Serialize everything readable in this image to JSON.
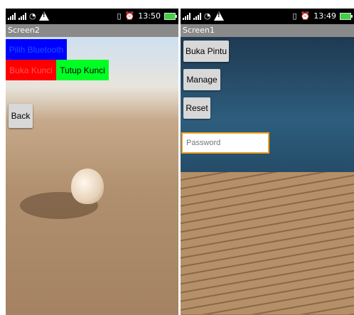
{
  "left_phone": {
    "status": {
      "time": "13:50"
    },
    "title": "Screen2",
    "buttons": {
      "pilih": "Pilih Bluetooth",
      "buka": "Buka Kunci",
      "tutup": "Tutup Kunci",
      "back": "Back"
    }
  },
  "right_phone": {
    "status": {
      "time": "13:49"
    },
    "title": "Screen1",
    "buttons": {
      "buka_pintu": "Buka Pintu",
      "manage": "Manage",
      "reset": "Reset"
    },
    "password": {
      "placeholder": "Password",
      "value": ""
    }
  },
  "colors": {
    "pilih_bg": "#0000ff",
    "buka_bg": "#ff0000",
    "tutup_bg": "#00ff22",
    "titlebar": "#8a8a8a",
    "input_border": "#f0a020"
  }
}
